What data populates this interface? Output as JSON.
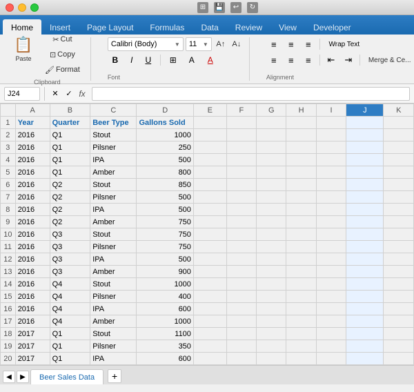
{
  "titleBar": {
    "trafficLights": [
      "close",
      "minimize",
      "maximize"
    ]
  },
  "ribbonTabs": {
    "tabs": [
      "Home",
      "Insert",
      "Page Layout",
      "Formulas",
      "Data",
      "Review",
      "View",
      "Developer"
    ],
    "activeTab": "Home"
  },
  "toolbar": {
    "pasteLabel": "Paste",
    "cutLabel": "Cut",
    "copyLabel": "Copy",
    "formatLabel": "Format",
    "fontName": "Calibri (Body)",
    "fontSize": "11",
    "boldLabel": "B",
    "italicLabel": "I",
    "underlineLabel": "U",
    "wrapTextLabel": "Wrap Text",
    "mergeCellsLabel": "Merge & Ce...",
    "textLabel": "Text"
  },
  "formulaBar": {
    "cellRef": "J24",
    "xLabel": "✕",
    "checkLabel": "✓",
    "fxLabel": "fx",
    "formula": ""
  },
  "spreadsheet": {
    "columns": [
      "",
      "A",
      "B",
      "C",
      "D",
      "E",
      "F",
      "G",
      "H",
      "I",
      "J",
      "K"
    ],
    "selectedCell": "J",
    "rows": [
      {
        "rowNum": 1,
        "a": "Year",
        "b": "Quarter",
        "c": "Beer Type",
        "d": "Gallons Sold",
        "e": "",
        "f": "",
        "g": "",
        "h": "",
        "i": "",
        "j": "",
        "k": "",
        "isHeader": true
      },
      {
        "rowNum": 2,
        "a": "2016",
        "b": "Q1",
        "c": "Stout",
        "d": "1000",
        "e": "",
        "f": "",
        "g": "",
        "h": "",
        "i": "",
        "j": "",
        "k": ""
      },
      {
        "rowNum": 3,
        "a": "2016",
        "b": "Q1",
        "c": "Pilsner",
        "d": "250",
        "e": "",
        "f": "",
        "g": "",
        "h": "",
        "i": "",
        "j": "",
        "k": ""
      },
      {
        "rowNum": 4,
        "a": "2016",
        "b": "Q1",
        "c": "IPA",
        "d": "500",
        "e": "",
        "f": "",
        "g": "",
        "h": "",
        "i": "",
        "j": "",
        "k": ""
      },
      {
        "rowNum": 5,
        "a": "2016",
        "b": "Q1",
        "c": "Amber",
        "d": "800",
        "e": "",
        "f": "",
        "g": "",
        "h": "",
        "i": "",
        "j": "",
        "k": ""
      },
      {
        "rowNum": 6,
        "a": "2016",
        "b": "Q2",
        "c": "Stout",
        "d": "850",
        "e": "",
        "f": "",
        "g": "",
        "h": "",
        "i": "",
        "j": "",
        "k": ""
      },
      {
        "rowNum": 7,
        "a": "2016",
        "b": "Q2",
        "c": "Pilsner",
        "d": "500",
        "e": "",
        "f": "",
        "g": "",
        "h": "",
        "i": "",
        "j": "",
        "k": ""
      },
      {
        "rowNum": 8,
        "a": "2016",
        "b": "Q2",
        "c": "IPA",
        "d": "500",
        "e": "",
        "f": "",
        "g": "",
        "h": "",
        "i": "",
        "j": "",
        "k": ""
      },
      {
        "rowNum": 9,
        "a": "2016",
        "b": "Q2",
        "c": "Amber",
        "d": "750",
        "e": "",
        "f": "",
        "g": "",
        "h": "",
        "i": "",
        "j": "",
        "k": ""
      },
      {
        "rowNum": 10,
        "a": "2016",
        "b": "Q3",
        "c": "Stout",
        "d": "750",
        "e": "",
        "f": "",
        "g": "",
        "h": "",
        "i": "",
        "j": "",
        "k": ""
      },
      {
        "rowNum": 11,
        "a": "2016",
        "b": "Q3",
        "c": "Pilsner",
        "d": "750",
        "e": "",
        "f": "",
        "g": "",
        "h": "",
        "i": "",
        "j": "",
        "k": ""
      },
      {
        "rowNum": 12,
        "a": "2016",
        "b": "Q3",
        "c": "IPA",
        "d": "500",
        "e": "",
        "f": "",
        "g": "",
        "h": "",
        "i": "",
        "j": "",
        "k": ""
      },
      {
        "rowNum": 13,
        "a": "2016",
        "b": "Q3",
        "c": "Amber",
        "d": "900",
        "e": "",
        "f": "",
        "g": "",
        "h": "",
        "i": "",
        "j": "",
        "k": ""
      },
      {
        "rowNum": 14,
        "a": "2016",
        "b": "Q4",
        "c": "Stout",
        "d": "1000",
        "e": "",
        "f": "",
        "g": "",
        "h": "",
        "i": "",
        "j": "",
        "k": ""
      },
      {
        "rowNum": 15,
        "a": "2016",
        "b": "Q4",
        "c": "Pilsner",
        "d": "400",
        "e": "",
        "f": "",
        "g": "",
        "h": "",
        "i": "",
        "j": "",
        "k": ""
      },
      {
        "rowNum": 16,
        "a": "2016",
        "b": "Q4",
        "c": "IPA",
        "d": "600",
        "e": "",
        "f": "",
        "g": "",
        "h": "",
        "i": "",
        "j": "",
        "k": ""
      },
      {
        "rowNum": 17,
        "a": "2016",
        "b": "Q4",
        "c": "Amber",
        "d": "1000",
        "e": "",
        "f": "",
        "g": "",
        "h": "",
        "i": "",
        "j": "",
        "k": ""
      },
      {
        "rowNum": 18,
        "a": "2017",
        "b": "Q1",
        "c": "Stout",
        "d": "1100",
        "e": "",
        "f": "",
        "g": "",
        "h": "",
        "i": "",
        "j": "",
        "k": ""
      },
      {
        "rowNum": 19,
        "a": "2017",
        "b": "Q1",
        "c": "Pilsner",
        "d": "350",
        "e": "",
        "f": "",
        "g": "",
        "h": "",
        "i": "",
        "j": "",
        "k": ""
      },
      {
        "rowNum": 20,
        "a": "2017",
        "b": "Q1",
        "c": "IPA",
        "d": "600",
        "e": "",
        "f": "",
        "g": "",
        "h": "",
        "i": "",
        "j": "",
        "k": ""
      }
    ]
  },
  "sheetTabs": {
    "tabs": [
      "Beer Sales Data"
    ],
    "activeTab": "Beer Sales Data",
    "addLabel": "+"
  }
}
